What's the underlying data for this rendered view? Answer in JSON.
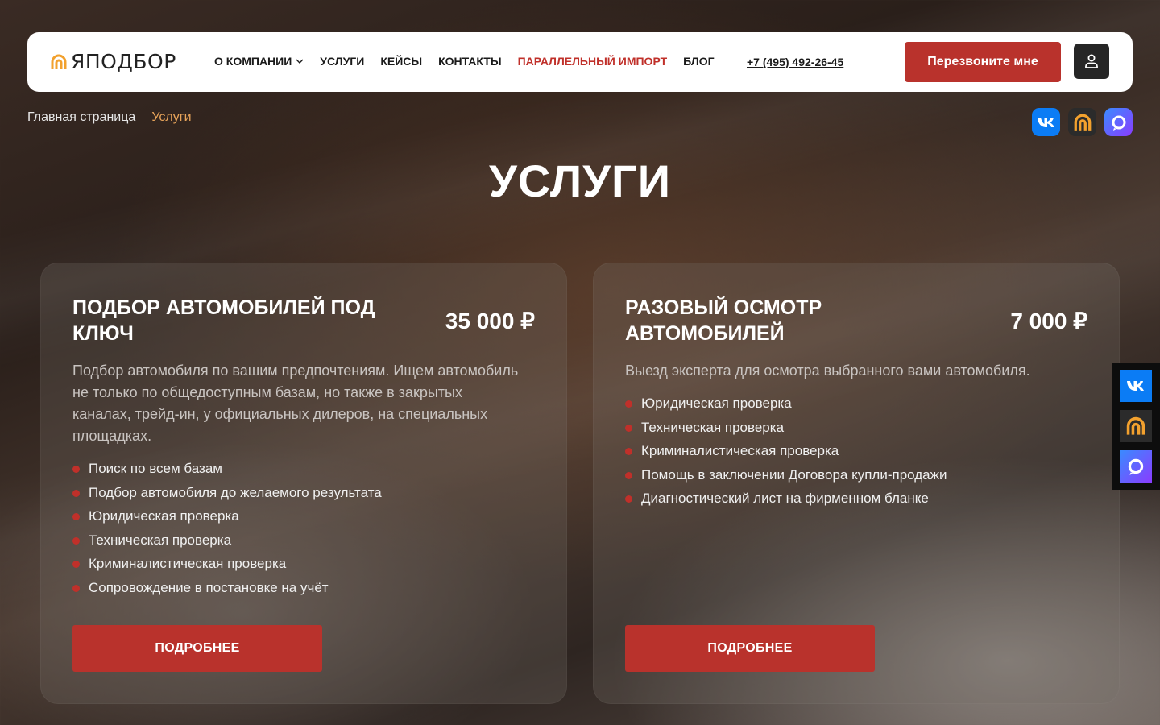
{
  "header": {
    "logo_text": "ЯПОДБОР",
    "nav": [
      {
        "label": "О КОМПАНИИ",
        "has_dropdown": true
      },
      {
        "label": "УСЛУГИ"
      },
      {
        "label": "КЕЙСЫ"
      },
      {
        "label": "КОНТАКТЫ"
      },
      {
        "label": "ПАРАЛЛЕЛЬНЫЙ ИМПОРТ",
        "accent": true
      },
      {
        "label": "БЛОГ"
      }
    ],
    "phone": "+7 (495) 492-26-45",
    "callback_label": "Перезвоните мне",
    "user_icon": "user-icon"
  },
  "breadcrumb": {
    "home": "Главная страница",
    "current": "Услуги"
  },
  "social": [
    "vk-icon",
    "dzen-icon",
    "max-icon"
  ],
  "page_title": "УСЛУГИ",
  "cards": [
    {
      "title": "ПОДБОР АВТОМОБИЛЕЙ ПОД КЛЮЧ",
      "price": "35 000 ₽",
      "description": "Подбор автомобиля по вашим предпочтениям. Ищем автомобиль не только по общедоступным базам, но также в закрытых каналах, трейд-ин, у официальных дилеров, на специальных площадках.",
      "features": [
        "Поиск по всем базам",
        "Подбор автомобиля до желаемого результата",
        "Юридическая проверка",
        "Техническая проверка",
        "Криминалистическая проверка",
        "Сопровождение в постановке на учёт"
      ],
      "button_label": "ПОДРОБНЕЕ"
    },
    {
      "title": "РАЗОВЫЙ ОСМОТР АВТОМОБИЛЕЙ",
      "price": "7 000 ₽",
      "description": "Выезд эксперта для осмотра выбранного вами автомобиля.",
      "features": [
        "Юридическая проверка",
        "Техническая проверка",
        "Криминалистическая проверка",
        "Помощь в заключении Договора купли-продажи",
        "Диагностический лист на фирменном бланке"
      ],
      "button_label": "ПОДРОБНЕЕ"
    }
  ],
  "colors": {
    "accent_red": "#b9322c",
    "breadcrumb_current": "#e8a45a",
    "logo_orange": "#f2a12e"
  }
}
